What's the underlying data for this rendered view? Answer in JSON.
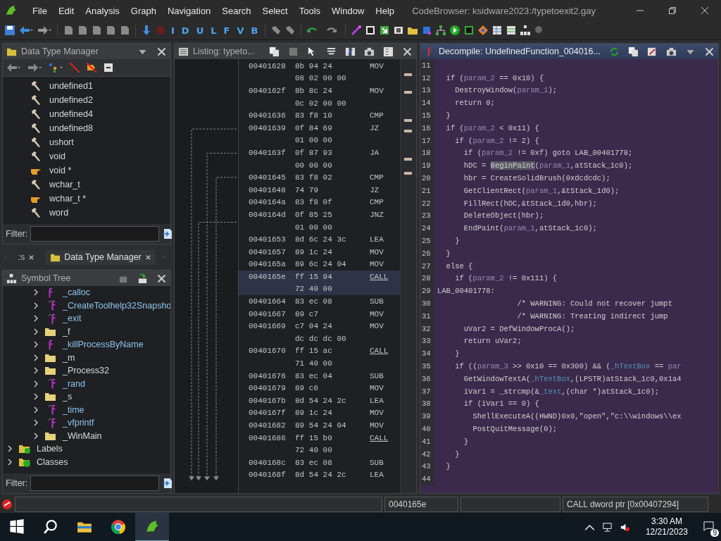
{
  "window": {
    "title": "CodeBrowser: ksidware2023:/typetoexit2.gay"
  },
  "menu": [
    "File",
    "Edit",
    "Analysis",
    "Graph",
    "Navigation",
    "Search",
    "Select",
    "Tools",
    "Window",
    "Help"
  ],
  "toolbar": {
    "letters": [
      "I",
      "D",
      "U",
      "L",
      "F",
      "V",
      "B"
    ]
  },
  "data_type_manager": {
    "title": "Data Type Manager",
    "filter_label": "Filter:",
    "items": [
      {
        "label": "undefined1",
        "kind": "builtin"
      },
      {
        "label": "undefined2",
        "kind": "builtin"
      },
      {
        "label": "undefined4",
        "kind": "builtin"
      },
      {
        "label": "undefined8",
        "kind": "builtin"
      },
      {
        "label": "ushort",
        "kind": "builtin"
      },
      {
        "label": "void",
        "kind": "builtin"
      },
      {
        "label": "void *",
        "kind": "pointer"
      },
      {
        "label": "wchar_t",
        "kind": "builtin"
      },
      {
        "label": "wchar_t *",
        "kind": "pointer"
      },
      {
        "label": "word",
        "kind": "builtin"
      }
    ]
  },
  "lower_tabs": [
    {
      "label": ":s",
      "selected": false
    },
    {
      "label": "Data Type Manager",
      "selected": true
    }
  ],
  "symbol_tree": {
    "title": "Symbol Tree",
    "filter_label": "Filter:",
    "items": [
      {
        "children": [
          {
            "label": "_calloc",
            "kind": "function",
            "expanded": false
          },
          {
            "label": "_CreateToolhelp32Snapsho",
            "kind": "thunk",
            "expanded": false
          },
          {
            "label": "_exit",
            "kind": "thunk",
            "expanded": false
          },
          {
            "label": "_f",
            "kind": "folder",
            "expanded": false
          },
          {
            "label": "_killProcessByName",
            "kind": "function",
            "expanded": false
          },
          {
            "label": "_m",
            "kind": "folder",
            "expanded": false
          },
          {
            "label": "_Process32",
            "kind": "folder",
            "expanded": false
          },
          {
            "label": "_rand",
            "kind": "thunk",
            "expanded": false
          },
          {
            "label": "_s",
            "kind": "folder",
            "expanded": false
          },
          {
            "label": "_time",
            "kind": "thunk",
            "expanded": false
          },
          {
            "label": "_vfprintf",
            "kind": "thunk",
            "expanded": false
          },
          {
            "label": "_WinMain",
            "kind": "folder",
            "expanded": false
          }
        ]
      },
      {
        "label": "Labels",
        "kind": "labels",
        "expanded": false
      },
      {
        "label": "Classes",
        "kind": "classes",
        "expanded": false
      }
    ]
  },
  "listing": {
    "title": "Listing:  typeto...",
    "instructions": [
      {
        "address": "00401628",
        "bytes": [
          "8b 94 24",
          "08 02 00 00"
        ],
        "mnemonic": "MOV",
        "reference": false,
        "selected": false
      },
      {
        "address": "0040162f",
        "bytes": [
          "8b 8c 24",
          "0c 02 00 00"
        ],
        "mnemonic": "MOV",
        "reference": false,
        "selected": false
      },
      {
        "address": "00401636",
        "bytes": [
          "83 f8 10"
        ],
        "mnemonic": "CMP",
        "reference": false,
        "selected": false
      },
      {
        "address": "00401639",
        "bytes": [
          "0f 84 69",
          "01 00 00"
        ],
        "mnemonic": "JZ",
        "reference": false,
        "selected": false
      },
      {
        "address": "0040163f",
        "bytes": [
          "0f 87 93",
          "00 00 00"
        ],
        "mnemonic": "JA",
        "reference": false,
        "selected": false
      },
      {
        "address": "00401645",
        "bytes": [
          "83 f8 02"
        ],
        "mnemonic": "CMP",
        "reference": false,
        "selected": false
      },
      {
        "address": "00401648",
        "bytes": [
          "74 79"
        ],
        "mnemonic": "JZ",
        "reference": false,
        "selected": false
      },
      {
        "address": "0040164a",
        "bytes": [
          "83 f8 0f"
        ],
        "mnemonic": "CMP",
        "reference": false,
        "selected": false
      },
      {
        "address": "0040164d",
        "bytes": [
          "0f 85 25",
          "01 00 00"
        ],
        "mnemonic": "JNZ",
        "reference": false,
        "selected": false
      },
      {
        "address": "00401653",
        "bytes": [
          "8d 6c 24 3c"
        ],
        "mnemonic": "LEA",
        "reference": false,
        "selected": false
      },
      {
        "address": "00401657",
        "bytes": [
          "89 1c 24"
        ],
        "mnemonic": "MOV",
        "reference": false,
        "selected": false
      },
      {
        "address": "0040165a",
        "bytes": [
          "89 6c 24 04"
        ],
        "mnemonic": "MOV",
        "reference": false,
        "selected": false
      },
      {
        "address": "0040165e",
        "bytes": [
          "ff 15 94",
          "72 40 00"
        ],
        "mnemonic": "CALL",
        "reference": true,
        "selected": true
      },
      {
        "address": "00401664",
        "bytes": [
          "83 ec 08"
        ],
        "mnemonic": "SUB",
        "reference": false,
        "selected": false
      },
      {
        "address": "00401667",
        "bytes": [
          "89 c7"
        ],
        "mnemonic": "MOV",
        "reference": false,
        "selected": false
      },
      {
        "address": "00401669",
        "bytes": [
          "c7 04 24",
          "dc dc dc 00"
        ],
        "mnemonic": "MOV",
        "reference": false,
        "selected": false
      },
      {
        "address": "00401670",
        "bytes": [
          "ff 15 ac",
          "71 40 00"
        ],
        "mnemonic": "CALL",
        "reference": true,
        "selected": false
      },
      {
        "address": "00401676",
        "bytes": [
          "83 ec 04"
        ],
        "mnemonic": "SUB",
        "reference": false,
        "selected": false
      },
      {
        "address": "00401679",
        "bytes": [
          "89 c6"
        ],
        "mnemonic": "MOV",
        "reference": false,
        "selected": false
      },
      {
        "address": "0040167b",
        "bytes": [
          "8d 54 24 2c"
        ],
        "mnemonic": "LEA",
        "reference": false,
        "selected": false
      },
      {
        "address": "0040167f",
        "bytes": [
          "89 1c 24"
        ],
        "mnemonic": "MOV",
        "reference": false,
        "selected": false
      },
      {
        "address": "00401682",
        "bytes": [
          "89 54 24 04"
        ],
        "mnemonic": "MOV",
        "reference": false,
        "selected": false
      },
      {
        "address": "00401686",
        "bytes": [
          "ff 15 b0",
          "72 40 00"
        ],
        "mnemonic": "CALL",
        "reference": true,
        "selected": false
      },
      {
        "address": "0040168c",
        "bytes": [
          "83 ec 08"
        ],
        "mnemonic": "SUB",
        "reference": false,
        "selected": false
      },
      {
        "address": "0040168f",
        "bytes": [
          "8d 54 24 2c"
        ],
        "mnemonic": "LEA",
        "reference": false,
        "selected": false
      }
    ]
  },
  "decompile": {
    "title": "Decompile: UndefinedFunction_004016...",
    "lines": [
      {
        "number": "11"
      },
      {
        "number": "12",
        "segments": [
          {
            "kind": "code",
            "text": "  if ("
          },
          {
            "kind": "param",
            "text": "param_2"
          },
          {
            "kind": "code",
            "text": " == 0x10) {"
          }
        ]
      },
      {
        "number": "13",
        "segments": [
          {
            "kind": "code",
            "text": "    DestroyWindow("
          },
          {
            "kind": "param",
            "text": "param_1"
          },
          {
            "kind": "code",
            "text": ");"
          }
        ]
      },
      {
        "number": "14",
        "segments": [
          {
            "kind": "code",
            "text": "    return 0;"
          }
        ]
      },
      {
        "number": "15",
        "segments": [
          {
            "kind": "code",
            "text": "  }"
          }
        ]
      },
      {
        "number": "16",
        "segments": [
          {
            "kind": "code",
            "text": "  if ("
          },
          {
            "kind": "param",
            "text": "param_2"
          },
          {
            "kind": "code",
            "text": " < 0x11) {"
          }
        ]
      },
      {
        "number": "17",
        "segments": [
          {
            "kind": "code",
            "text": "    if ("
          },
          {
            "kind": "param",
            "text": "param_2"
          },
          {
            "kind": "code",
            "text": " != 2) {"
          }
        ]
      },
      {
        "number": "18",
        "segments": [
          {
            "kind": "code",
            "text": "      if ("
          },
          {
            "kind": "param",
            "text": "param_2"
          },
          {
            "kind": "code",
            "text": " != 0xf) goto LAB_00401778;"
          }
        ]
      },
      {
        "number": "19",
        "segments": [
          {
            "kind": "code",
            "text": "      hDC = "
          },
          {
            "kind": "highlight",
            "text": "BeginPaint"
          },
          {
            "kind": "code",
            "text": "("
          },
          {
            "kind": "param",
            "text": "param_1"
          },
          {
            "kind": "code",
            "text": ",atStack_1c0);"
          }
        ]
      },
      {
        "number": "20",
        "segments": [
          {
            "kind": "code",
            "text": "      hbr = CreateSolidBrush(0xdcdcdc);"
          }
        ]
      },
      {
        "number": "21",
        "segments": [
          {
            "kind": "code",
            "text": "      GetClientRect("
          },
          {
            "kind": "param",
            "text": "param_1"
          },
          {
            "kind": "code",
            "text": ",&tStack_1d0);"
          }
        ]
      },
      {
        "number": "22",
        "segments": [
          {
            "kind": "code",
            "text": "      FillRect(hDC,&tStack_1d0,hbr);"
          }
        ]
      },
      {
        "number": "23",
        "segments": [
          {
            "kind": "code",
            "text": "      DeleteObject(hbr);"
          }
        ]
      },
      {
        "number": "24",
        "segments": [
          {
            "kind": "code",
            "text": "      EndPaint("
          },
          {
            "kind": "param",
            "text": "param_1"
          },
          {
            "kind": "code",
            "text": ",atStack_1c0);"
          }
        ]
      },
      {
        "number": "25",
        "segments": [
          {
            "kind": "code",
            "text": "    }"
          }
        ]
      },
      {
        "number": "26",
        "segments": [
          {
            "kind": "code",
            "text": "  }"
          }
        ]
      },
      {
        "number": "27",
        "segments": [
          {
            "kind": "code",
            "text": "  else {"
          }
        ]
      },
      {
        "number": "28",
        "segments": [
          {
            "kind": "code",
            "text": "    if ("
          },
          {
            "kind": "param",
            "text": "param_2"
          },
          {
            "kind": "code",
            "text": " != 0x111) {"
          }
        ]
      },
      {
        "number": "29",
        "segments": [
          {
            "kind": "code",
            "text": "LAB_00401778:"
          }
        ]
      },
      {
        "number": "30",
        "segments": [
          {
            "kind": "code",
            "text": "                  /* WARNING: Could not recover jumpt"
          }
        ]
      },
      {
        "number": "31",
        "segments": [
          {
            "kind": "code",
            "text": "                  /* WARNING: Treating indirect jump"
          }
        ]
      },
      {
        "number": "32",
        "segments": [
          {
            "kind": "code",
            "text": "      uVar2 = DefWindowProcA();"
          }
        ]
      },
      {
        "number": "33",
        "segments": [
          {
            "kind": "code",
            "text": "      return uVar2;"
          }
        ]
      },
      {
        "number": "34",
        "segments": [
          {
            "kind": "code",
            "text": "    }"
          }
        ]
      },
      {
        "number": "35",
        "segments": [
          {
            "kind": "code",
            "text": "    if (("
          },
          {
            "kind": "param",
            "text": "param_3"
          },
          {
            "kind": "code",
            "text": " >> 0x10 == 0x300) && ("
          },
          {
            "kind": "global",
            "text": "_hTextBox"
          },
          {
            "kind": "code",
            "text": " == "
          },
          {
            "kind": "param",
            "text": "par"
          }
        ]
      },
      {
        "number": "36",
        "segments": [
          {
            "kind": "code",
            "text": "      GetWindowTextA("
          },
          {
            "kind": "global",
            "text": "_hTextBox"
          },
          {
            "kind": "code",
            "text": ",(LPSTR)atStack_1c0,0x1a4"
          }
        ]
      },
      {
        "number": "37",
        "segments": [
          {
            "kind": "code",
            "text": "      iVar1 = _strcmp(&"
          },
          {
            "kind": "global",
            "text": "_text"
          },
          {
            "kind": "code",
            "text": ",(char *)atStack_1c0);"
          }
        ]
      },
      {
        "number": "38",
        "segments": [
          {
            "kind": "code",
            "text": "      if (iVar1 == 0) {"
          }
        ]
      },
      {
        "number": "39",
        "segments": [
          {
            "kind": "code",
            "text": "        ShellExecuteA((HWND)0x0,\"open\",\"c:\\\\windows\\\\ex"
          }
        ]
      },
      {
        "number": "40",
        "segments": [
          {
            "kind": "code",
            "text": "        PostQuitMessage(0);"
          }
        ]
      },
      {
        "number": "41",
        "segments": [
          {
            "kind": "code",
            "text": "      }"
          }
        ]
      },
      {
        "number": "42",
        "segments": [
          {
            "kind": "code",
            "text": "    }"
          }
        ]
      },
      {
        "number": "43",
        "segments": [
          {
            "kind": "code",
            "text": "  }"
          }
        ]
      },
      {
        "number": "44"
      }
    ]
  },
  "status_bar": {
    "address": "0040165e",
    "instruction": "CALL dword ptr [0x00407294]"
  },
  "taskbar": {
    "time": "3:30 AM",
    "date": "12/21/2023",
    "notifications": "9"
  }
}
